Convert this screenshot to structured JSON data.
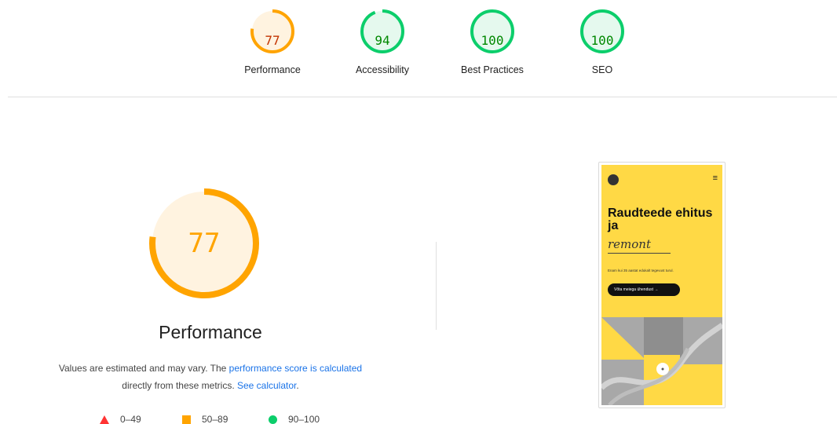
{
  "scores": [
    {
      "value": "77",
      "label": "Performance",
      "fraction": 0.77,
      "color": "#ffa400",
      "text_color": "#c33300",
      "bg": "#fff3e0"
    },
    {
      "value": "94",
      "label": "Accessibility",
      "fraction": 0.94,
      "color": "#0cce6b",
      "text_color": "#008800",
      "bg": "#e5f9ee"
    },
    {
      "value": "100",
      "label": "Best Practices",
      "fraction": 1.0,
      "color": "#0cce6b",
      "text_color": "#008800",
      "bg": "#e5f9ee"
    },
    {
      "value": "100",
      "label": "SEO",
      "fraction": 1.0,
      "color": "#0cce6b",
      "text_color": "#008800",
      "bg": "#e5f9ee"
    }
  ],
  "performance": {
    "score": "77",
    "fraction": 0.77,
    "title": "Performance",
    "desc_prefix": "Values are estimated and may vary. The ",
    "desc_link1": "performance score is calculated",
    "desc_middle": "directly from these metrics. ",
    "desc_link2": "See calculator",
    "desc_suffix": "."
  },
  "legend": {
    "fail": "0–49",
    "average": "50–89",
    "pass": "90–100"
  },
  "screenshot": {
    "headline": "Raudteede ehitus ja",
    "headline_italic": "remont",
    "subtext": "Enam kui 35 aastat edukalt tegevust turul.",
    "cta": "Võta meiega ühendust →",
    "menu_icon": "≡"
  },
  "colors": {
    "orange": "#ffa400",
    "green": "#0cce6b",
    "red": "#ff3333",
    "link": "#1a73e8",
    "phone_yellow": "#ffd945"
  }
}
